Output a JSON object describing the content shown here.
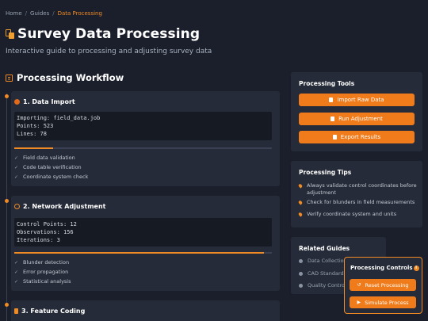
{
  "breadcrumb": {
    "items": [
      "Home",
      "Guides"
    ],
    "current": "Data Processing"
  },
  "header": {
    "title": "Survey Data Processing",
    "subtitle": "Interactive guide to processing and adjusting survey data"
  },
  "workflow": {
    "heading": "Processing Workflow",
    "steps": [
      {
        "title": "1. Data Import",
        "console": [
          "Importing: field_data.job",
          "Points: 523",
          "Lines: 78"
        ],
        "progress": 0.15,
        "checks": [
          "Field data validation",
          "Code table verification",
          "Coordinate system check"
        ]
      },
      {
        "title": "2. Network Adjustment",
        "console": [
          "Control Points: 12",
          "Observations: 156",
          "Iterations: 3"
        ],
        "progress": 0.97,
        "checks": [
          "Blunder detection",
          "Error propagation",
          "Statistical analysis"
        ]
      },
      {
        "title": "3. Feature Coding"
      }
    ]
  },
  "tools": {
    "title": "Processing Tools",
    "buttons": [
      "Import Raw Data",
      "Run Adjustment",
      "Export Results"
    ]
  },
  "tips": {
    "title": "Processing Tips",
    "items": [
      "Always validate control coordinates before adjustment",
      "Check for blunders in field measurements",
      "Verify coordinate system and units"
    ]
  },
  "related": {
    "title": "Related Guides",
    "items": [
      "Data Collectio",
      "CAD Standard",
      "Quality Contro"
    ]
  },
  "controls": {
    "title": "Processing Controls",
    "buttons": [
      "Reset Processing",
      "Simulate Process"
    ]
  },
  "colors": {
    "accent": "#f08a24",
    "button": "#f07b1a",
    "background": "#1a1f2b",
    "card": "#252b38"
  }
}
